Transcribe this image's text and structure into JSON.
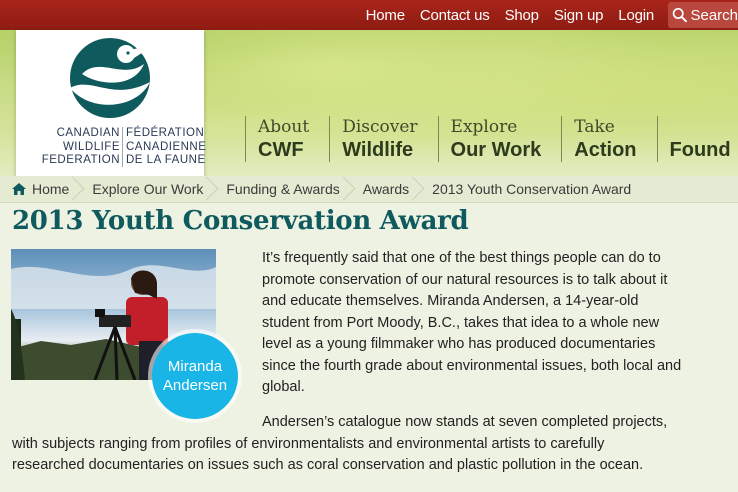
{
  "topnav": {
    "links": [
      "Home",
      "Contact us",
      "Shop",
      "Sign up",
      "Login"
    ],
    "search_label": "Search",
    "search_icon": "search-icon"
  },
  "logo": {
    "en_line1": "CANADIAN",
    "en_line2": "WILDLIFE",
    "en_line3": "FEDERATION",
    "fr_line1": "FÉDÉRATION",
    "fr_line2": "CANADIENNE",
    "fr_line3": "DE LA FAUNE"
  },
  "mainnav": [
    {
      "small": "About",
      "big": "CWF"
    },
    {
      "small": "Discover",
      "big": "Wildlife"
    },
    {
      "small": "Explore",
      "big": "Our Work"
    },
    {
      "small": "Take",
      "big": "Action"
    },
    {
      "small": "",
      "big": "Found"
    }
  ],
  "breadcrumb": [
    "Home",
    "Explore Our Work",
    "Funding & Awards",
    "Awards",
    "2013 Youth Conservation Award"
  ],
  "page_title": "2013 Youth Conservation Award",
  "badge": {
    "line1": "Miranda",
    "line2": "Andersen"
  },
  "para1": [
    "It’s frequently said that one of the best things people can do to",
    "promote conservation of our natural resources is to talk about it",
    "and educate themselves. Miranda Andersen, a 14-year-old",
    "student from Port Moody, B.C., takes that idea to a whole new",
    "level as a young filmmaker who has produced documentaries",
    "since the fourth grade about environmental issues, both local and",
    "global."
  ],
  "para2": [
    "Andersen’s catalogue now stands at seven completed projects,",
    "with subjects ranging from profiles of environmentalists and environmental artists to carefully",
    "researched documentaries on issues such as coral conservation and plastic pollution in the ocean."
  ],
  "colors": {
    "topbar": "#9e2118",
    "title": "#0f5a5e",
    "badge": "#19b5e6"
  }
}
